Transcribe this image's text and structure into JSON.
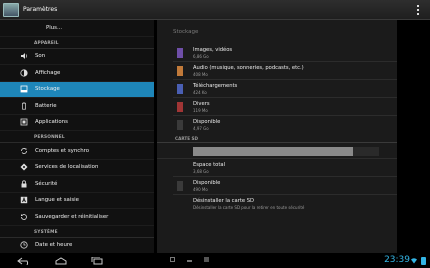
{
  "actionbar": {
    "title": "Paramètres"
  },
  "left": {
    "plus": "Plus...",
    "sections": [
      {
        "header": "APPAREIL",
        "items": [
          "Son",
          "Affichage",
          "Stockage",
          "Batterie",
          "Applications"
        ]
      },
      {
        "header": "PERSONNEL",
        "items": [
          "Comptes et synchro",
          "Services de localisation",
          "Sécurité",
          "Langue et saisie",
          "Sauvegarder et réinitialiser"
        ]
      },
      {
        "header": "SYSTÈME",
        "items": [
          "Date et heure"
        ]
      }
    ]
  },
  "storage": {
    "breadcrumb": "Stockage",
    "rows": [
      {
        "title": "Images, vidéos",
        "sub": "6,86 Go",
        "color": "#6f4fa8"
      },
      {
        "title": "Audio (musique, sonneries, podcasts, etc.)",
        "sub": "408 Mo",
        "color": "#c17a3a"
      },
      {
        "title": "Téléchargements",
        "sub": "424 Ko",
        "color": "#4a5fb3"
      },
      {
        "title": "Divers",
        "sub": "119 Mo",
        "color": "#a03535"
      },
      {
        "title": "Disponible",
        "sub": "4,97 Go",
        "color": "#3a3a3a"
      }
    ],
    "sd_header": "CARTE SD",
    "sd_fill_fraction": 0.86,
    "sd_rows": [
      {
        "title": "Espace total",
        "sub": "3,68 Go",
        "color": ""
      },
      {
        "title": "Disponible",
        "sub": "490 Mo",
        "color": "#3a3a3a"
      },
      {
        "title": "Désinstaller la carte SD",
        "sub": "Désinstaller la carte SD pour la retirer en toute sécurité",
        "color": ""
      }
    ]
  },
  "statusbar": {
    "clock": "23:39"
  }
}
